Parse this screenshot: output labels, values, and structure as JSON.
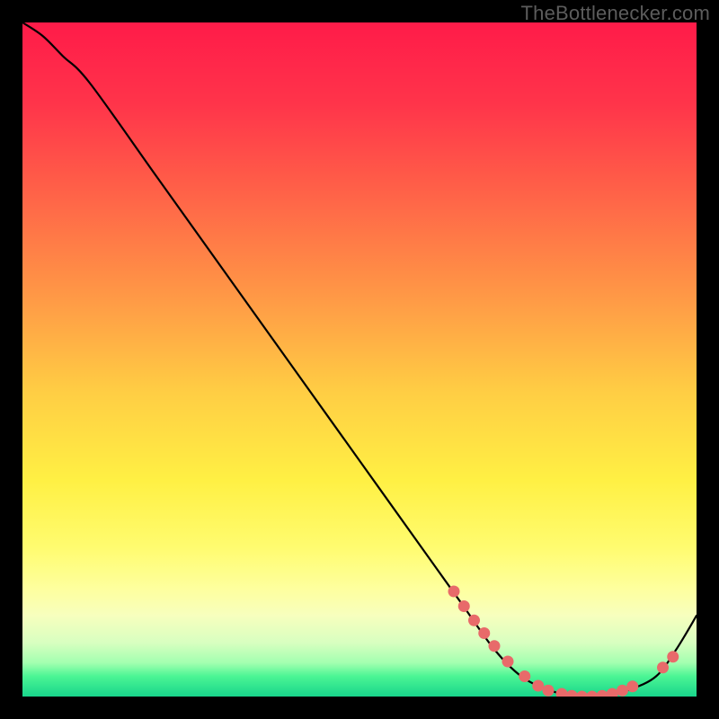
{
  "watermark": "TheBottlenecker.com",
  "chart_data": {
    "type": "line",
    "title": "",
    "xlabel": "",
    "ylabel": "",
    "xlim": [
      0,
      100
    ],
    "ylim": [
      0,
      100
    ],
    "background_gradient": {
      "stops": [
        {
          "pct": 0,
          "color": "#ff1b49"
        },
        {
          "pct": 12,
          "color": "#ff344a"
        },
        {
          "pct": 25,
          "color": "#ff6148"
        },
        {
          "pct": 40,
          "color": "#ff9646"
        },
        {
          "pct": 55,
          "color": "#ffce44"
        },
        {
          "pct": 68,
          "color": "#fff044"
        },
        {
          "pct": 78,
          "color": "#fffc70"
        },
        {
          "pct": 84,
          "color": "#feff9e"
        },
        {
          "pct": 88,
          "color": "#f7ffbe"
        },
        {
          "pct": 92,
          "color": "#d8ffc0"
        },
        {
          "pct": 95,
          "color": "#a3ffb0"
        },
        {
          "pct": 97,
          "color": "#4bf594"
        },
        {
          "pct": 100,
          "color": "#18d58b"
        }
      ]
    },
    "series": [
      {
        "name": "bottleneck-curve",
        "x": [
          0,
          3,
          6,
          10,
          20,
          30,
          40,
          50,
          60,
          65,
          70,
          74,
          78,
          82,
          86,
          90,
          94,
          97,
          100
        ],
        "y": [
          100,
          98,
          95,
          91,
          77,
          63,
          49,
          35,
          21,
          14,
          7,
          3,
          1,
          0,
          0,
          1,
          3,
          7,
          12
        ]
      }
    ],
    "scatter_points": {
      "name": "highlight-dots",
      "color": "#e86a6a",
      "points": [
        {
          "x": 64,
          "y": 15.6
        },
        {
          "x": 65.5,
          "y": 13.4
        },
        {
          "x": 67,
          "y": 11.3
        },
        {
          "x": 68.5,
          "y": 9.4
        },
        {
          "x": 70,
          "y": 7.5
        },
        {
          "x": 72,
          "y": 5.2
        },
        {
          "x": 74.5,
          "y": 3.0
        },
        {
          "x": 76.5,
          "y": 1.6
        },
        {
          "x": 78,
          "y": 0.9
        },
        {
          "x": 80,
          "y": 0.4
        },
        {
          "x": 81.5,
          "y": 0.1
        },
        {
          "x": 83,
          "y": 0.0
        },
        {
          "x": 84.5,
          "y": 0.0
        },
        {
          "x": 86,
          "y": 0.1
        },
        {
          "x": 87.5,
          "y": 0.4
        },
        {
          "x": 89,
          "y": 0.9
        },
        {
          "x": 90.5,
          "y": 1.5
        },
        {
          "x": 95,
          "y": 4.3
        },
        {
          "x": 96.5,
          "y": 5.9
        }
      ]
    }
  }
}
